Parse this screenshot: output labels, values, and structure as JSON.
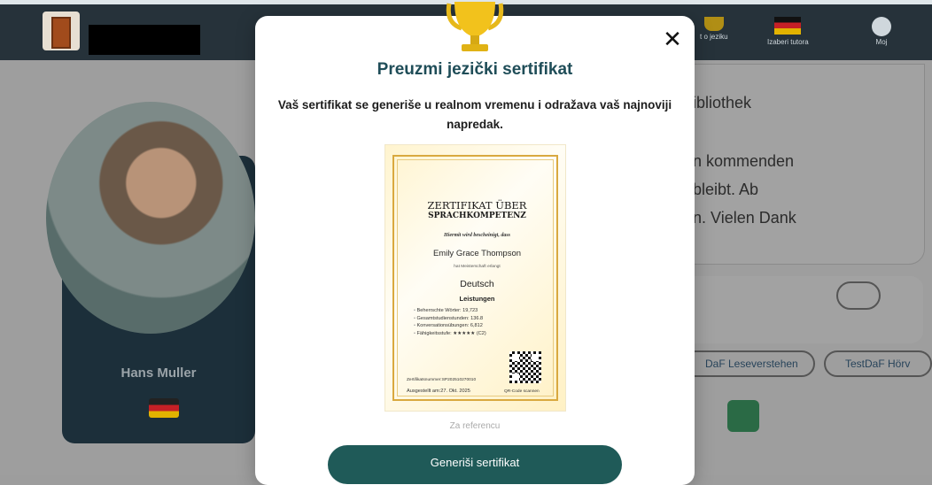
{
  "header": {
    "redacted_title": "",
    "nav": [
      {
        "label": "t o jeziku",
        "icon": "trophy-icon"
      },
      {
        "label": "Izaberi tutora",
        "icon": "german-flag-icon"
      },
      {
        "label": "Moj",
        "icon": "profile-icon"
      }
    ]
  },
  "profile": {
    "name": "Hans Muller"
  },
  "background": {
    "lines": [
      "ibliothek",
      "n kommenden",
      "bleibt. Ab",
      "n. Vielen Dank"
    ],
    "pills": [
      "DaF Leseverstehen",
      "TestDaF Hörv"
    ]
  },
  "modal": {
    "title": "Preuzmi jezički sertifikat",
    "description": "Vaš sertifikat se generiše u realnom vremenu i odražava vaš najnoviji napredak.",
    "close_label": "✕",
    "reference_label": "Za referencu",
    "generate_button": "Generiši sertifikat"
  },
  "certificate": {
    "title_line1": "ZERTIFIKAT ÜBER",
    "title_line2": "SPRACHKOMPETENZ",
    "intro": "Hiermit wird bescheinigt, dass",
    "name": "Emily Grace Thompson",
    "mastery": "hat Meisterschaft erlangt",
    "language": "Deutsch",
    "achievements_title": "Leistungen",
    "achievements": [
      "Beherrschte Wörter: 19,723",
      "Gesamtstudienstunden: 136.8",
      "Konversationsübungen: 6,812",
      "Fähigkeitsstufe: ★★★★★ (C2)"
    ],
    "number_label": "Zertifikatsnummer:",
    "number": "SP202510270010",
    "issued_label": "Ausgestellt am:",
    "issued_date": "27. Okt. 2025",
    "qr_label": "QR-Code scannen"
  }
}
